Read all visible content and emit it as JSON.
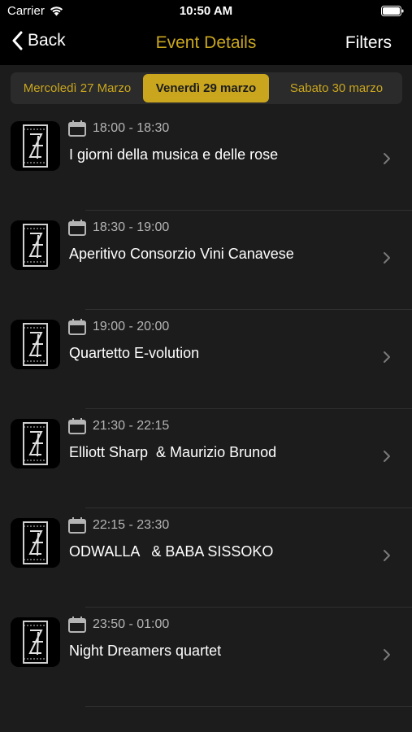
{
  "status_bar": {
    "carrier": "Carrier",
    "time": "10:50 AM"
  },
  "nav": {
    "back_label": "Back",
    "title": "Event Details",
    "filters_label": "Filters"
  },
  "colors": {
    "accent": "#c9a61e",
    "background": "#1c1c1c",
    "bar": "#000000"
  },
  "date_tabs": [
    {
      "label": "Mercoledì 27 Marzo",
      "selected": false
    },
    {
      "label": "Venerdì 29 marzo",
      "selected": true
    },
    {
      "label": "Sabato 30 marzo",
      "selected": false
    }
  ],
  "events": [
    {
      "time": "18:00 - 18:30",
      "title": "I giorni della musica e delle rose",
      "icon": "jazz-logo-icon"
    },
    {
      "time": "18:30 - 19:00",
      "title": "Aperitivo Consorzio Vini Canavese",
      "icon": "jazz-logo-icon"
    },
    {
      "time": "19:00 - 20:00",
      "title": "Quartetto E-volution",
      "icon": "jazz-logo-icon"
    },
    {
      "time": "21:30 - 22:15",
      "title": "Elliott Sharp  & Maurizio Brunod",
      "icon": "jazz-logo-icon"
    },
    {
      "time": "22:15 - 23:30",
      "title": "ODWALLA   & BABA SISSOKO",
      "icon": "jazz-logo-icon"
    },
    {
      "time": "23:50 - 01:00",
      "title": "Night Dreamers quartet",
      "icon": "jazz-logo-icon"
    }
  ]
}
